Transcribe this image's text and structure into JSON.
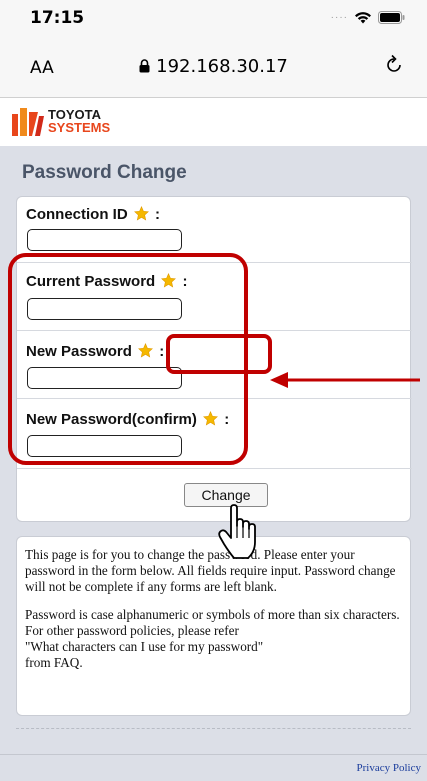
{
  "status_bar": {
    "time": "17:15"
  },
  "browser": {
    "text_size_label": "AA",
    "url": "192.168.30.17"
  },
  "site": {
    "logo_line1": "TOYOTA",
    "logo_line2": "SYSTEMS"
  },
  "page": {
    "title": "Password Change",
    "fields": [
      {
        "label": "Connection ID",
        "value": ""
      },
      {
        "label": "Current Password",
        "value": ""
      },
      {
        "label": "New Password",
        "value": ""
      },
      {
        "label": "New Password(confirm)",
        "value": ""
      }
    ],
    "colon": ":",
    "change_button": "Change",
    "info_paragraph1": "This page is for you to change the password. Please enter your password in the form below. All fields require input. Password change will not be complete if any forms are left blank.",
    "info_paragraph2_line1": "Password is case alphanumeric or symbols of more than six characters.",
    "info_paragraph2_line2": "For other password policies, please refer",
    "info_paragraph2_line3": "\"What characters can I use for my password\"",
    "info_paragraph2_line4": "from FAQ.",
    "privacy_link": "Privacy Policy"
  },
  "colors": {
    "highlight": "#c00000",
    "page_bg": "#dcdfe7",
    "title": "#4a5568",
    "star": "#f5b800"
  }
}
